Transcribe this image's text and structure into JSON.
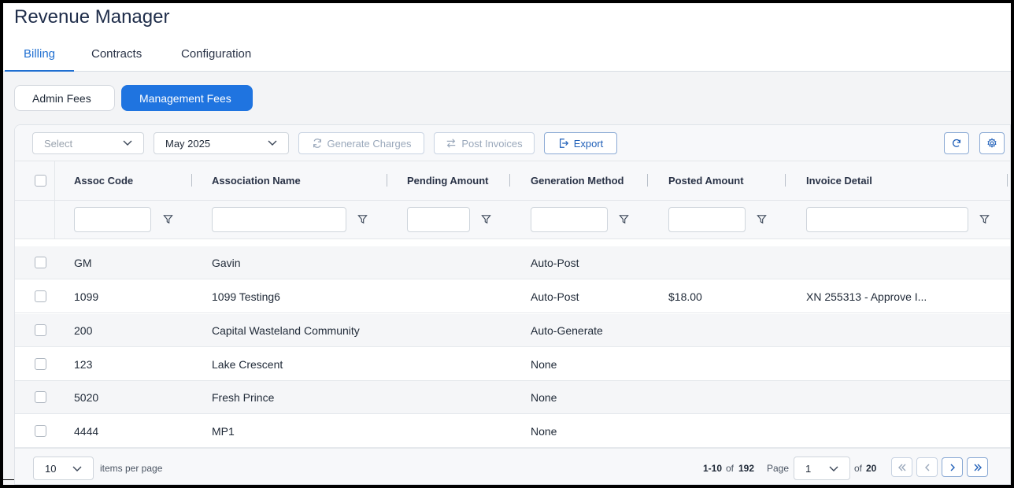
{
  "app": {
    "title": "Revenue Manager"
  },
  "tabs": [
    {
      "label": "Billing",
      "active": true
    },
    {
      "label": "Contracts",
      "active": false
    },
    {
      "label": "Configuration",
      "active": false
    }
  ],
  "subtabs": [
    {
      "label": "Admin Fees",
      "active": false
    },
    {
      "label": "Management Fees",
      "active": true
    }
  ],
  "toolbar": {
    "select_placeholder": "Select",
    "period_value": "May 2025",
    "generate_label": "Generate Charges",
    "post_label": "Post Invoices",
    "export_label": "Export"
  },
  "columns": [
    {
      "label": "Assoc Code"
    },
    {
      "label": "Association Name"
    },
    {
      "label": "Pending Amount"
    },
    {
      "label": "Generation Method"
    },
    {
      "label": "Posted Amount"
    },
    {
      "label": "Invoice Detail"
    }
  ],
  "rows": [
    {
      "code": "GM",
      "name": "Gavin",
      "pending": "",
      "method": "Auto-Post",
      "posted": "",
      "invoice": ""
    },
    {
      "code": "1099",
      "name": "1099 Testing6",
      "pending": "",
      "method": "Auto-Post",
      "posted": "$18.00",
      "invoice": "XN 255313 - Approve I..."
    },
    {
      "code": "200",
      "name": "Capital Wasteland Community",
      "pending": "",
      "method": "Auto-Generate",
      "posted": "",
      "invoice": ""
    },
    {
      "code": "123",
      "name": "Lake Crescent",
      "pending": "",
      "method": "None",
      "posted": "",
      "invoice": ""
    },
    {
      "code": "5020",
      "name": "Fresh Prince",
      "pending": "",
      "method": "None",
      "posted": "",
      "invoice": ""
    },
    {
      "code": "4444",
      "name": "MP1",
      "pending": "",
      "method": "None",
      "posted": "",
      "invoice": ""
    }
  ],
  "pager": {
    "page_size": "10",
    "items_per_page_label": "items per page",
    "range": "1-10",
    "of_label": "of",
    "total": "192",
    "page_label": "Page",
    "current_page": "1",
    "of_pages_label": "of",
    "total_pages": "20"
  },
  "colors": {
    "accent": "#1f74e0",
    "border": "#dfe3e8"
  }
}
